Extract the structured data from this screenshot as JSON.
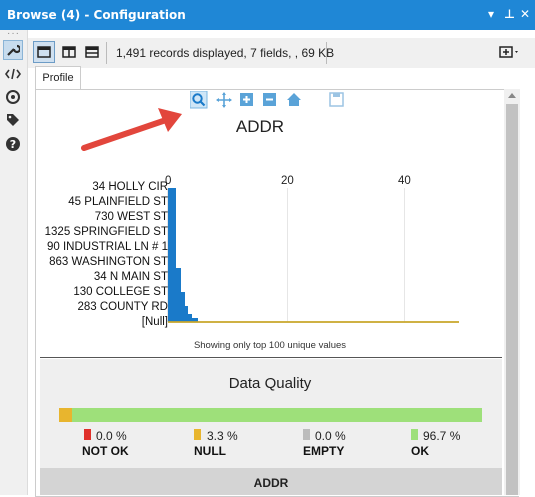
{
  "window": {
    "title": "Browse (4) - Configuration",
    "controls": [
      "▾",
      "⊥",
      "✕"
    ]
  },
  "leftbar": {
    "icons": [
      "wrench-icon",
      "code-icon",
      "connection-icon",
      "tag-icon",
      "help-icon"
    ]
  },
  "toolbar": {
    "status": "1,491 records displayed, 7 fields, , 69 KB"
  },
  "tabs": {
    "profile": "Profile"
  },
  "chart_toolbar": [
    "zoom-icon",
    "pan-icon",
    "zoom-in-icon",
    "zoom-out-icon",
    "home-icon",
    "save-icon"
  ],
  "chart_data": {
    "type": "bar",
    "orientation": "horizontal",
    "title": "ADDR",
    "categories": [
      "34 HOLLY CIR",
      "45 PLAINFIELD ST",
      "730 WEST ST",
      "1325 SPRINGFIELD ST",
      "90 INDUSTRIAL LN # 1",
      "863 WASHINGTON ST",
      "34 N MAIN ST",
      "130 COLLEGE ST",
      "283 COUNTY RD",
      "[Null]"
    ],
    "x_ticks": [
      "0",
      "20",
      "40"
    ],
    "xlim": [
      0,
      50
    ],
    "grid": true,
    "bar_color": "#1a7ac9",
    "null_line_color": "#c8a62a",
    "note": "Showing only top 100 unique values"
  },
  "data_quality": {
    "title": "Data Quality",
    "items": [
      {
        "pct": "0.0 %",
        "label": "NOT OK",
        "color": "#e0302a"
      },
      {
        "pct": "3.3 %",
        "label": "NULL",
        "color": "#e8b52e"
      },
      {
        "pct": "0.0 %",
        "label": "EMPTY",
        "color": "#bcbcbc"
      },
      {
        "pct": "96.7 %",
        "label": "OK",
        "color": "#9ee07a"
      }
    ]
  },
  "field_header": "ADDR"
}
